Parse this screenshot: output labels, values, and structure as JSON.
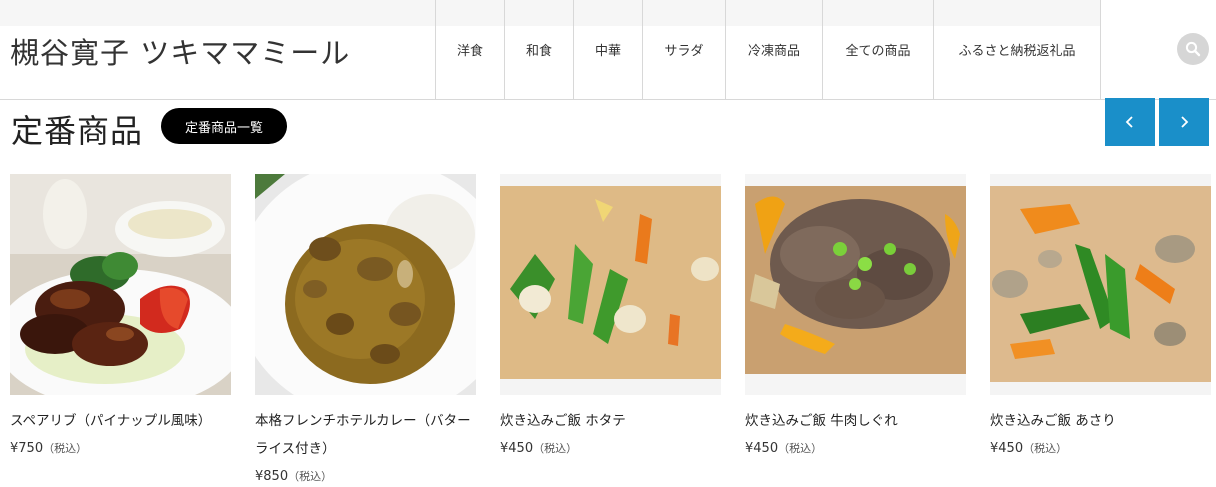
{
  "header": {
    "site_title": "槻谷寛子 ツキママミール",
    "nav": [
      "洋食",
      "和食",
      "中華",
      "サラダ",
      "冷凍商品",
      "全ての商品",
      "ふるさと納税返礼品"
    ]
  },
  "section": {
    "title": "定番商品",
    "list_button": "定番商品一覧"
  },
  "products": [
    {
      "name": "スペアリブ（パイナップル風味）",
      "price": "¥750",
      "tax": "（税込）"
    },
    {
      "name": "本格フレンチホテルカレー（バターライス付き）",
      "price": "¥850",
      "tax": "（税込）"
    },
    {
      "name": "炊き込みご飯 ホタテ",
      "price": "¥450",
      "tax": "（税込）"
    },
    {
      "name": "炊き込みご飯 牛肉しぐれ",
      "price": "¥450",
      "tax": "（税込）"
    },
    {
      "name": "炊き込みご飯 あさり",
      "price": "¥450",
      "tax": "（税込）"
    }
  ],
  "icons": {
    "search": "search-icon",
    "prev": "chevron-left-icon",
    "next": "chevron-right-icon"
  },
  "colors": {
    "accent_blue": "#1a8fc9",
    "button_black": "#000000",
    "search_gray": "#d6d6d6"
  }
}
